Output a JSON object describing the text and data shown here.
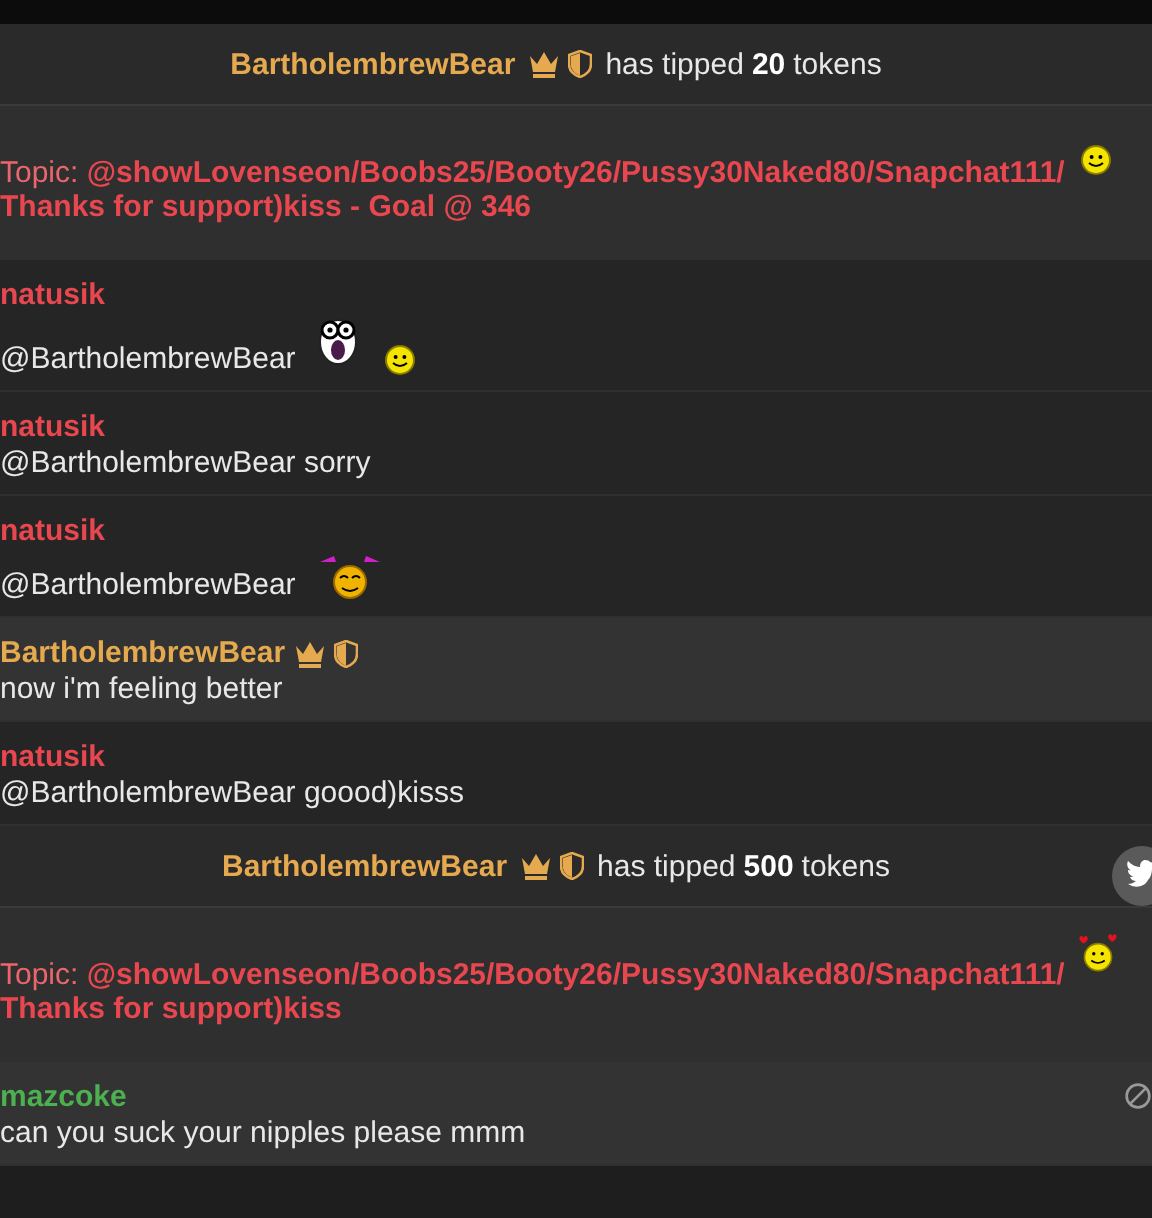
{
  "chat": [
    {
      "kind": "tip",
      "user": "BartholembrewBear",
      "crown": true,
      "shield": true,
      "action": "has tipped",
      "amount": "20",
      "unit": "tokens"
    },
    {
      "kind": "topic",
      "label": "Topic:",
      "text": "@showLovenseon/Boobs25/Booty26/Pussy30Naked80/Snapchat111/ Thanks for support)kiss - Goal @ 346",
      "emoticons": [
        {
          "kind": "smile"
        }
      ]
    },
    {
      "kind": "message",
      "user": "natusik",
      "color": "#e8474f",
      "highlighted": false,
      "text": "@BartholembrewBear",
      "emoticons": [
        {
          "kind": "shocked"
        },
        {
          "kind": "smile"
        }
      ]
    },
    {
      "kind": "message",
      "user": "natusik",
      "color": "#e8474f",
      "highlighted": false,
      "text": "@BartholembrewBear sorry"
    },
    {
      "kind": "message",
      "user": "natusik",
      "color": "#e8474f",
      "highlighted": false,
      "text": "@BartholembrewBear",
      "emoticons": [
        {
          "kind": "bow"
        }
      ]
    },
    {
      "kind": "message",
      "user": "BartholembrewBear",
      "color": "#e5a94f",
      "crown": true,
      "shield": true,
      "highlighted": true,
      "text": "now i'm feeling better"
    },
    {
      "kind": "message",
      "user": "natusik",
      "color": "#e8474f",
      "highlighted": false,
      "text": "@BartholembrewBear goood)kisss"
    },
    {
      "kind": "tip",
      "user": "BartholembrewBear",
      "crown": true,
      "shield": true,
      "action": "has tipped",
      "amount": "500",
      "unit": "tokens",
      "share": true
    },
    {
      "kind": "topic",
      "label": "Topic:",
      "text": "@showLovenseon/Boobs25/Booty26/Pussy30Naked80/Snapchat111/ Thanks for support)kiss",
      "emoticons": [
        {
          "kind": "hearts"
        }
      ]
    },
    {
      "kind": "message",
      "user": "mazcoke",
      "color": "#4caf50",
      "highlighted": true,
      "text": "can you suck your nipples please mmm",
      "muted": true
    }
  ]
}
